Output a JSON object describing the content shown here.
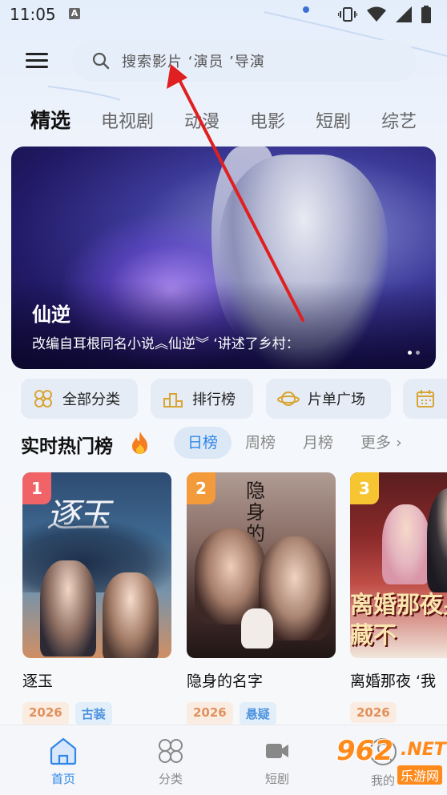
{
  "status_bar": {
    "time": "11:05",
    "a_badge": "A"
  },
  "header": {
    "menu_icon": "menu-icon",
    "search_placeholder": "搜索影片 ‘演员 ’导演"
  },
  "category_tabs": [
    {
      "label": "精选",
      "active": true
    },
    {
      "label": "电视剧",
      "active": false
    },
    {
      "label": "动漫",
      "active": false
    },
    {
      "label": "电影",
      "active": false
    },
    {
      "label": "短剧",
      "active": false
    },
    {
      "label": "综艺",
      "active": false
    }
  ],
  "banner": {
    "title": "仙逆",
    "description": "改编自耳根同名小说︽仙逆︾ ‘讲述了乡村：",
    "slide_count": 2,
    "active_slide": 1
  },
  "quick_entries": [
    {
      "label": "全部分类",
      "icon": "grid-flower-icon"
    },
    {
      "label": "排行榜",
      "icon": "podium-icon"
    },
    {
      "label": "片单广场",
      "icon": "planet-icon"
    },
    {
      "label": "",
      "icon": "calendar-icon"
    }
  ],
  "hot_list": {
    "title": "实时热门榜",
    "tabs": [
      {
        "label": "日榜",
        "active": true
      },
      {
        "label": "周榜",
        "active": false
      },
      {
        "label": "月榜",
        "active": false
      },
      {
        "label": "更多 ›",
        "active": false
      }
    ],
    "items": [
      {
        "rank": "1",
        "title": "逐玉",
        "poster_text": "逐玉",
        "year": "2026",
        "genre": "古装",
        "rank_color": "#f06468"
      },
      {
        "rank": "2",
        "title": "隐身的名字",
        "poster_text": "隐身的名字",
        "year": "2026",
        "genre": "悬疑",
        "rank_color": "#f39a3a"
      },
      {
        "rank": "3",
        "title": "离婚那夜 ‘我",
        "poster_text": "离婚那夜身份藏不",
        "year": "2026",
        "genre": "",
        "rank_color": "#f6c531"
      }
    ]
  },
  "bottom_nav": [
    {
      "label": "首页",
      "icon": "home-icon",
      "active": true
    },
    {
      "label": "分类",
      "icon": "category-icon",
      "active": false
    },
    {
      "label": "短剧",
      "icon": "video-icon",
      "active": false
    },
    {
      "label": "我的",
      "icon": "profile-icon",
      "active": false
    }
  ],
  "watermark": {
    "brand": "962",
    "suffix": ".NET",
    "cn": "乐游网"
  },
  "colors": {
    "accent": "#2f86e8",
    "tag_year": "#e0905c",
    "tag_genre": "#4c93dd"
  }
}
